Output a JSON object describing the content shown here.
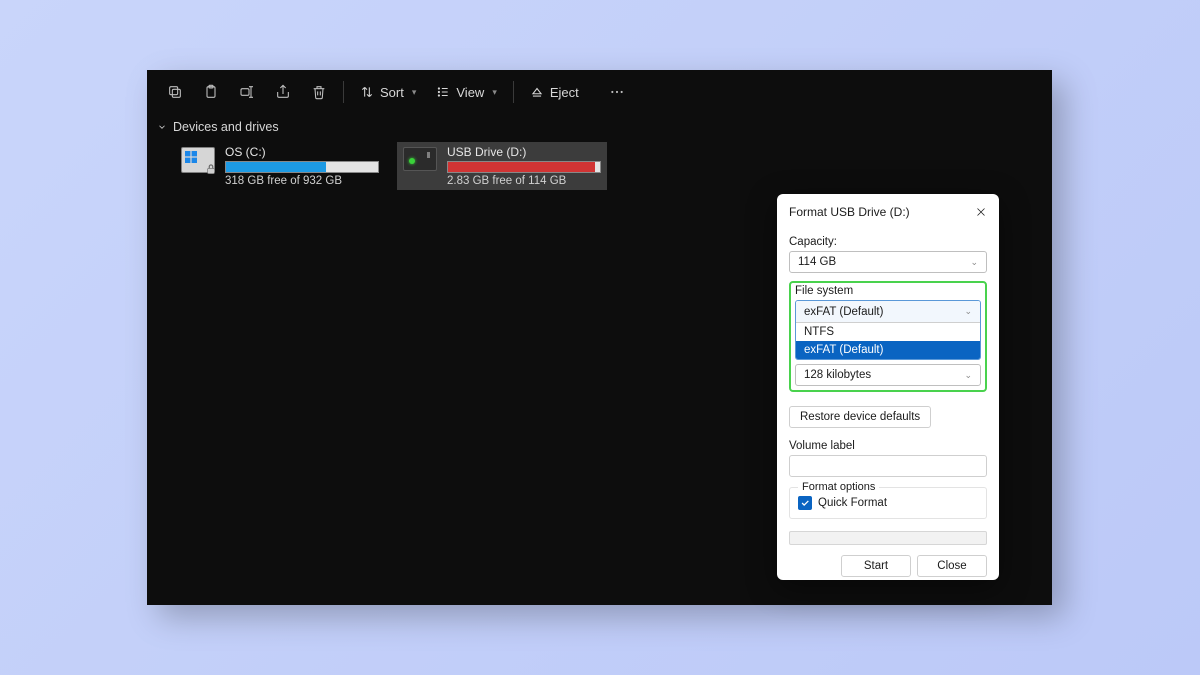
{
  "toolbar": {
    "sort_label": "Sort",
    "view_label": "View",
    "eject_label": "Eject"
  },
  "section_header": "Devices and drives",
  "drives": [
    {
      "title": "OS (C:)",
      "sub": "318 GB free of 932 GB",
      "fill_pct": 66,
      "fill_color": "fill-blue",
      "selected": false
    },
    {
      "title": "USB Drive (D:)",
      "sub": "2.83 GB free of 114 GB",
      "fill_pct": 97,
      "fill_color": "fill-red",
      "selected": true
    }
  ],
  "dialog": {
    "title": "Format USB Drive (D:)",
    "capacity_label": "Capacity:",
    "capacity_value": "114 GB",
    "fs_label": "File system",
    "fs_value": "exFAT (Default)",
    "fs_options": [
      "NTFS",
      "exFAT (Default)"
    ],
    "fs_hover_index": 1,
    "alloc_value": "128 kilobytes",
    "restore_btn": "Restore device defaults",
    "vol_label": "Volume label",
    "vol_value": "",
    "fmt_options_label": "Format options",
    "quick_format_label": "Quick Format",
    "quick_format_checked": true,
    "start_btn": "Start",
    "close_btn": "Close"
  },
  "colors": {
    "accent": "#0a64c2",
    "highlight": "#49d24d"
  }
}
